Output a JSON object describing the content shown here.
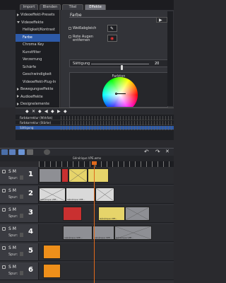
{
  "tabs": [
    "Import",
    "Blenden",
    "Titel",
    "Effekte"
  ],
  "active_tab": "Effekte",
  "effects_menu": [
    {
      "label": "Videoeffekt-Presets",
      "level": "cat",
      "arrow": "right"
    },
    {
      "label": "Videoeffekte",
      "level": "cat",
      "arrow": "down"
    },
    {
      "label": "Helligkeit/Kontrast",
      "level": "sub"
    },
    {
      "label": "Farbe",
      "level": "sub",
      "selected": true
    },
    {
      "label": "Chroma Key",
      "level": "sub"
    },
    {
      "label": "Kunstfilter",
      "level": "sub"
    },
    {
      "label": "Verzerrung",
      "level": "sub"
    },
    {
      "label": "Schärfe",
      "level": "sub"
    },
    {
      "label": "Geschwindigkeit",
      "level": "sub"
    },
    {
      "label": "Videoeffekt-Plug-In",
      "level": "sub"
    },
    {
      "label": "Bewegungseffekte",
      "level": "cat",
      "arrow": "right"
    },
    {
      "label": "Audioeffekte",
      "level": "cat",
      "arrow": "right"
    },
    {
      "label": "Designelemente",
      "level": "cat",
      "arrow": "right"
    }
  ],
  "settings": {
    "title": "Farbe",
    "checkbox_1": "Weißabgleich",
    "checkbox_2_line1": "Rote Augen",
    "checkbox_2_line2": "entfernen",
    "slider_label": "Sättigung",
    "slider_value": "20",
    "slider_fraction": 0.52,
    "colorwheel_label": "Farbton"
  },
  "keyframe_toolbar": [
    "◆",
    "✕",
    "◆",
    "◀",
    "◆",
    "▶",
    "◆"
  ],
  "keyframe_rows": [
    {
      "label": "Farbkorrektur (Wirkfak)"
    },
    {
      "label": "Farbkorrektur (Stärke)"
    },
    {
      "label": "Sättigung",
      "selected": true
    }
  ],
  "timeline_filename": "Générique VPE.wmv",
  "tracks": [
    {
      "num": "1",
      "sm": "S M",
      "spur": "Spur:",
      "clips": [
        {
          "color": "grey",
          "start": 0.0,
          "end": 0.17,
          "label": ""
        },
        {
          "color": "red",
          "start": 0.17,
          "end": 0.22,
          "label": ""
        },
        {
          "color": "yellow",
          "start": 0.22,
          "end": 0.36,
          "label": "",
          "x": true
        },
        {
          "color": "yellow",
          "start": 0.36,
          "end": 0.52,
          "label": ""
        }
      ]
    },
    {
      "num": "2",
      "sm": "S M",
      "spur": "Spur:",
      "clips": [
        {
          "color": "white",
          "start": 0.0,
          "end": 0.2,
          "label": "Générique VPE...",
          "x": true
        },
        {
          "color": "white",
          "start": 0.2,
          "end": 0.42,
          "label": "Générique VPE..."
        },
        {
          "color": "white",
          "start": 0.42,
          "end": 0.56,
          "label": "",
          "x": true
        }
      ]
    },
    {
      "num": "3",
      "sm": "S M",
      "spur": "Spur:",
      "clips": [
        {
          "color": "red",
          "start": 0.18,
          "end": 0.32,
          "label": ""
        },
        {
          "color": "yellow",
          "start": 0.44,
          "end": 0.64,
          "label": "Générique VPE..."
        },
        {
          "color": "grey",
          "start": 0.64,
          "end": 0.82,
          "label": "",
          "x": true
        }
      ]
    },
    {
      "num": "4",
      "sm": "S M",
      "spur": "Spur:",
      "clips": [
        {
          "color": "grey",
          "start": 0.18,
          "end": 0.4,
          "label": "Générique VPE..."
        },
        {
          "color": "grey",
          "start": 0.4,
          "end": 0.56,
          "label": "Générique VPE..."
        },
        {
          "color": "grey",
          "start": 0.56,
          "end": 0.84,
          "label": "Générique VPE...",
          "x": true
        }
      ]
    },
    {
      "num": "5",
      "sm": "S M",
      "spur": "Spur:",
      "clips": [
        {
          "color": "orange",
          "start": 0.03,
          "end": 0.16,
          "label": ""
        }
      ]
    },
    {
      "num": "6",
      "sm": "S M",
      "spur": "Spur:",
      "clips": [
        {
          "color": "orange",
          "start": 0.03,
          "end": 0.16,
          "label": ""
        }
      ]
    }
  ],
  "playhead_fraction": 0.41,
  "colors": {
    "selection": "#2d5aa8",
    "playhead": "#e06a1c"
  }
}
